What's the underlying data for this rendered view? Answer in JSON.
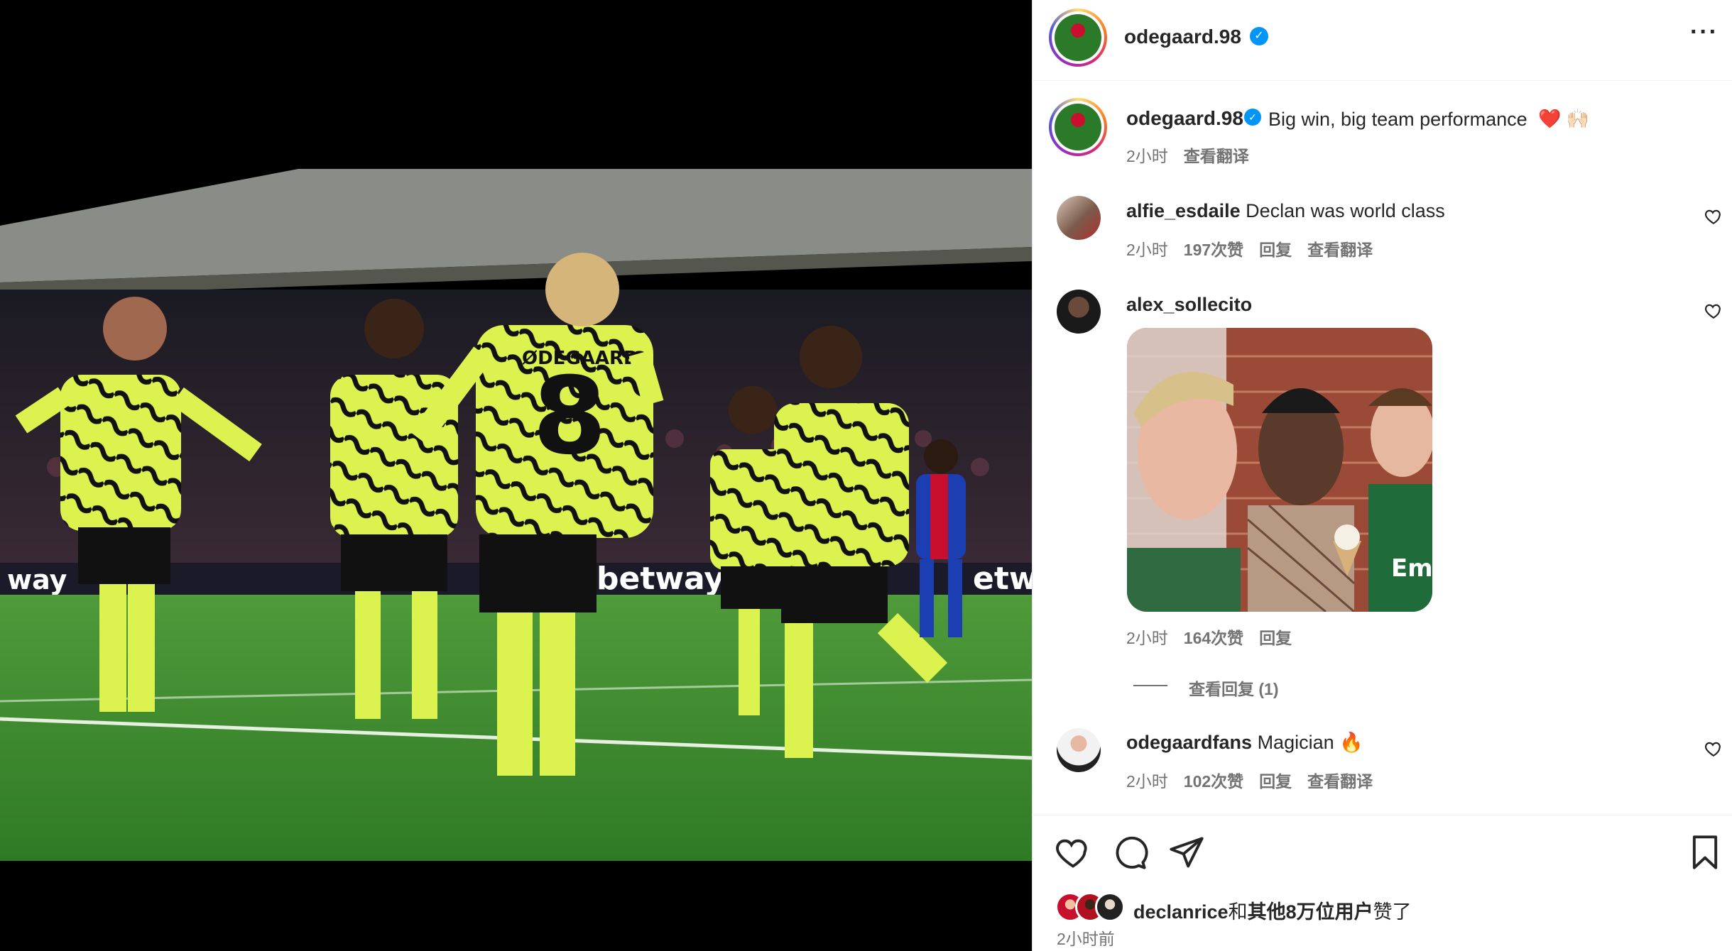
{
  "post": {
    "author": "odegaard.98",
    "caption_text": "Big win, big team performance",
    "caption_emoji": "❤️ 🙌🏻",
    "time": "2小时",
    "see_translation": "查看翻译"
  },
  "comments": [
    {
      "user": "alfie_esdaile",
      "text": "Declan was world class",
      "time": "2小时",
      "likes": "197次赞",
      "reply": "回复",
      "translate": "查看翻译"
    },
    {
      "user": "alex_sollecito",
      "text": "",
      "time": "2小时",
      "likes": "164次赞",
      "reply": "回复",
      "view_replies": "查看回复 (1)"
    },
    {
      "user": "odegaardfans",
      "text": "Magician",
      "emoji": "🔥",
      "time": "2小时",
      "likes": "102次赞",
      "reply": "回复",
      "translate": "查看翻译"
    }
  ],
  "footer": {
    "liked_by_user": "declanrice",
    "liked_by_connector": "和",
    "liked_by_others": "其他8万位用户",
    "liked_by_suffix": "赞了",
    "timestamp": "2小时前"
  },
  "icons": {
    "more": "more-horizontal-icon",
    "verified": "verified-badge-icon",
    "like": "heart-icon",
    "comment": "comment-icon",
    "share": "share-icon",
    "save": "bookmark-icon"
  },
  "colors": {
    "verified": "#0095f6",
    "heart_red": "#ff3040",
    "secondary_text": "#737373",
    "kit_yellow": "#d9f24a",
    "pitch_green": "#3f8a2e"
  }
}
